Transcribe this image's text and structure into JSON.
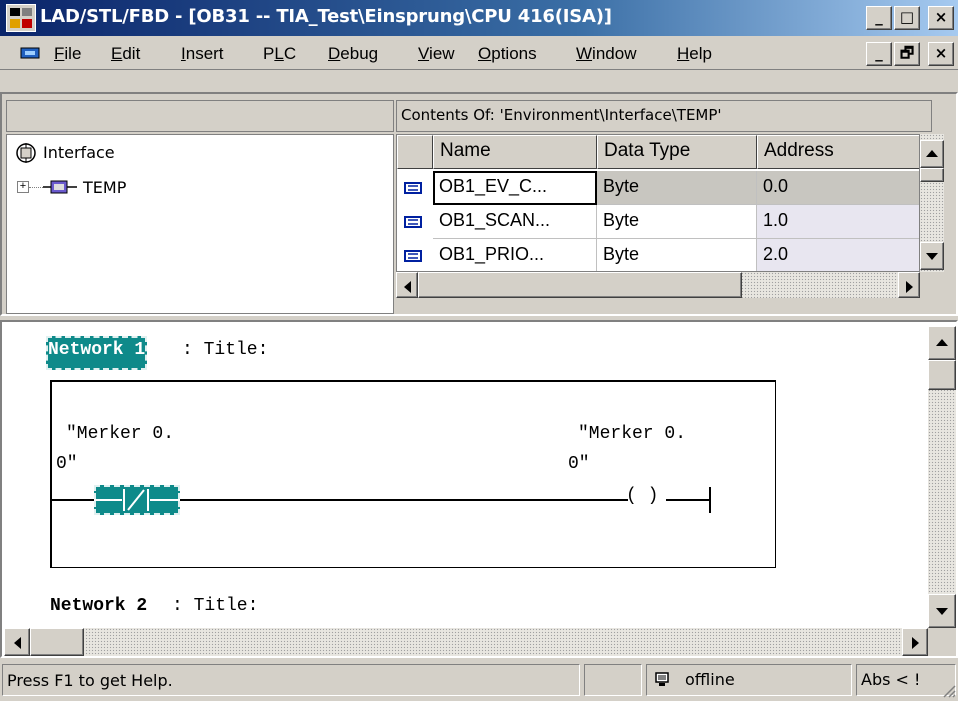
{
  "window": {
    "title": "LAD/STL/FBD  - [OB31 -- TIA_Test\\Einsprung\\CPU 416(ISA)]",
    "outer_buttons": [
      "_",
      "□",
      "×"
    ],
    "inner_buttons": [
      "_",
      "🗗",
      "×"
    ]
  },
  "menu": {
    "items": [
      "File",
      "Edit",
      "Insert",
      "PLC",
      "Debug",
      "View",
      "Options",
      "Window",
      "Help"
    ],
    "underlines": [
      "F",
      "E",
      "I",
      "L",
      "D",
      "V",
      "O",
      "W",
      "H"
    ]
  },
  "tree": {
    "root_label": "Interface",
    "child_label": "TEMP",
    "expander": "+"
  },
  "contents": {
    "header": "Contents Of: 'Environment\\Interface\\TEMP'",
    "columns": [
      "Name",
      "Data Type",
      "Address"
    ],
    "rows": [
      {
        "name": "OB1_EV_C...",
        "type": "Byte",
        "address": "0.0"
      },
      {
        "name": "OB1_SCAN...",
        "type": "Byte",
        "address": "1.0"
      },
      {
        "name": "OB1_PRIO...",
        "type": "Byte",
        "address": "2.0"
      }
    ]
  },
  "editor": {
    "network1": {
      "label": "Network 1",
      "title": ": Title:"
    },
    "contact": {
      "operand_line1": "\"Merker 0.",
      "operand_line2": "0\""
    },
    "coil": {
      "operand_line1": "\"Merker 0.",
      "operand_line2": "0\"",
      "symbol": "( )"
    },
    "network2": {
      "label": "Network 2",
      "title": " : Title:"
    }
  },
  "status": {
    "help": "Press F1 to get Help.",
    "mode": "offline",
    "abs": "Abs < !"
  },
  "colors": {
    "titlebar_start": "#0a246a",
    "titlebar_end": "#a6caf0",
    "selection_teal": "#0e8a8a",
    "highlight_row": "#d4d0c8"
  }
}
